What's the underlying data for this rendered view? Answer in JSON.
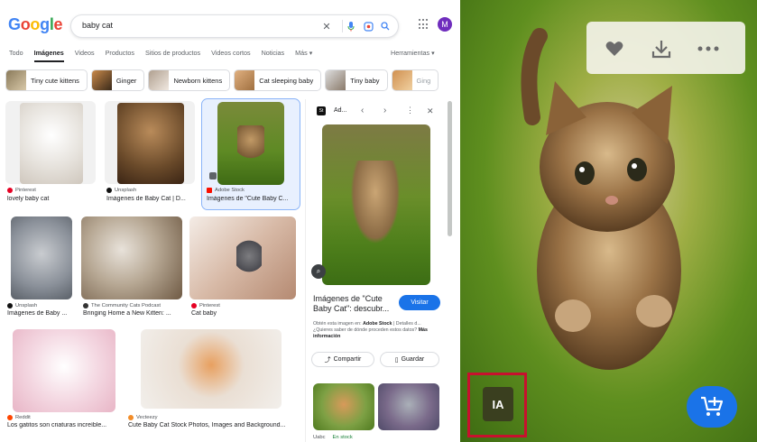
{
  "header": {
    "logo": [
      "G",
      "o",
      "o",
      "g",
      "l",
      "e"
    ],
    "logo_colors": [
      "#4285F4",
      "#EA4335",
      "#FBBC05",
      "#4285F4",
      "#34A853",
      "#EA4335"
    ],
    "query": "baby cat",
    "avatar_letter": "M"
  },
  "tabs": [
    "Todo",
    "Imágenes",
    "Videos",
    "Productos",
    "Sitios de productos",
    "Videos cortos",
    "Noticias",
    "Más ▾"
  ],
  "active_tab_index": 1,
  "tools_label": "Herramientas ▾",
  "chips": [
    "Tiny cute kittens",
    "Ginger",
    "Newborn kittens",
    "Cat sleeping baby",
    "Tiny baby",
    "Ging"
  ],
  "results": [
    {
      "source": "Pinterest",
      "title": "lovely baby cat"
    },
    {
      "source": "Unsplash",
      "title": "Imágenes de Baby Cat | D..."
    },
    {
      "source": "Adobe Stock",
      "title": "Imágenes de \"Cute Baby C..."
    },
    {
      "source": "Unsplash",
      "title": "Imágenes de Baby ..."
    },
    {
      "source": "The Community Cats Podcast",
      "title": "Bringing Home a New Kitten: ..."
    },
    {
      "source": "Pinterest",
      "title": "Cat baby"
    },
    {
      "source": "Reddit",
      "title": "Los gatitos son criaturas increíble..."
    },
    {
      "source": "Vecteezy",
      "title": "Cute Baby Cat Stock Photos, Images and Background..."
    }
  ],
  "panel": {
    "site": "Ad...",
    "title": "Imágenes de \"Cute Baby Cat\": descubr...",
    "visit": "Visitar",
    "desc_prefix": "Obtén esta imagen en: ",
    "desc_site": "Adobe Stock",
    "desc_suffix": " | Detalles d...",
    "desc_line2": "¿Quieres saber de dónde proceden estos datos?",
    "more_info": "Más información",
    "share": "Compartir",
    "save": "Guardar",
    "related_source": "Uabc",
    "related_stock": "En stock"
  },
  "viewer": {
    "ia_badge": "IA",
    "icons": [
      "heart-icon",
      "download-icon",
      "more-icon",
      "add-to-cart-icon"
    ]
  },
  "colors": {
    "accent": "#1a73e8",
    "highlight": "#c8102e"
  }
}
